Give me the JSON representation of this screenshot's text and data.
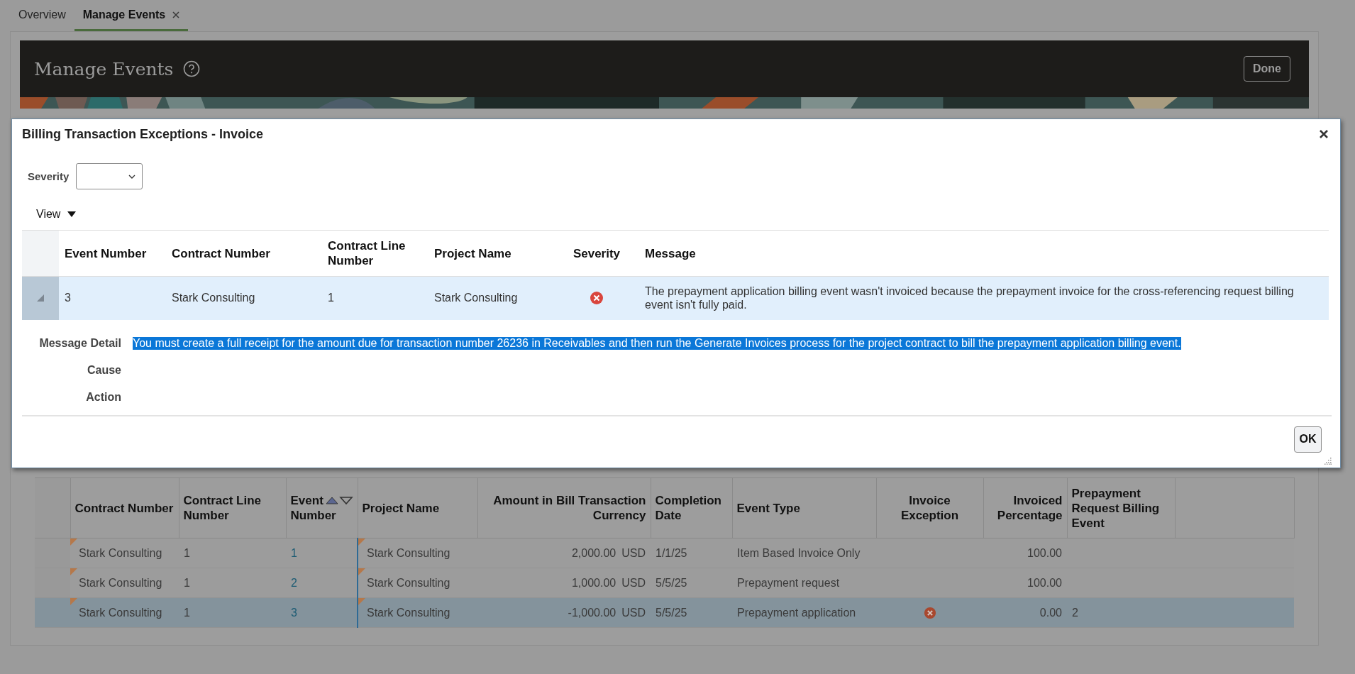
{
  "tabs": [
    {
      "label": "Overview",
      "selected": false,
      "closable": false
    },
    {
      "label": "Manage Events",
      "selected": true,
      "closable": true
    }
  ],
  "header": {
    "title": "Manage Events",
    "done_button": "Done"
  },
  "events_table": {
    "columns": [
      {
        "label": "Contract Number",
        "sortable": false
      },
      {
        "label": "Contract Line Number",
        "sortable": false
      },
      {
        "label": "Event Number",
        "sortable": true
      },
      {
        "label": "Project Name",
        "sortable": false
      },
      {
        "label": "Amount in Bill Transaction Currency",
        "sortable": false
      },
      {
        "label": "Completion Date",
        "sortable": false
      },
      {
        "label": "Event Type",
        "sortable": false
      },
      {
        "label": "Invoice Exception",
        "sortable": false
      },
      {
        "label": "Invoiced Percentage",
        "sortable": false
      },
      {
        "label": "Prepayment Request Billing Event",
        "sortable": false
      }
    ],
    "rows": [
      {
        "contract_number": "Stark Consulting",
        "contract_line": "1",
        "event_number": "1",
        "project_name": "Stark Consulting",
        "amount": "2,000.00",
        "currency": "USD",
        "completion_date": "1/1/25",
        "event_type": "Item Based Invoice Only",
        "invoice_exception": false,
        "invoiced_percentage": "100.00",
        "selected": false
      },
      {
        "contract_number": "Stark Consulting",
        "contract_line": "1",
        "event_number": "2",
        "project_name": "Stark Consulting",
        "amount": "1,000.00",
        "currency": "USD",
        "completion_date": "5/5/25",
        "event_type": "Prepayment request",
        "invoice_exception": false,
        "invoiced_percentage": "100.00",
        "selected": false
      },
      {
        "contract_number": "Stark Consulting",
        "contract_line": "1",
        "event_number": "3",
        "project_name": "Stark Consulting",
        "amount": "-1,000.00",
        "currency": "USD",
        "completion_date": "5/5/25",
        "event_type": "Prepayment application",
        "invoice_exception": true,
        "invoiced_percentage": "0.00",
        "prepayment_request_event": "2",
        "selected": true
      }
    ]
  },
  "dialog": {
    "title": "Billing Transaction Exceptions - Invoice",
    "severity_filter": {
      "label": "Severity"
    },
    "view_menu": "View",
    "columns": [
      "Event Number",
      "Contract Number",
      "Contract Line Number",
      "Project Name",
      "Severity",
      "Message"
    ],
    "rows": [
      {
        "event_number": "3",
        "contract_number": "Stark Consulting",
        "contract_line": "1",
        "project_name": "Stark Consulting",
        "kind": "error",
        "message": "The prepayment application billing event wasn't invoiced because the prepayment invoice for the cross-referencing request billing event isn't fully paid.",
        "selected": true
      }
    ],
    "details": [
      {
        "label": "Message Detail",
        "value": "You must create a full receipt for the amount due for transaction number 26236 in Receivables and then run the Generate Invoices process for the project contract to bill the prepayment application billing event.",
        "highlighted": true
      },
      {
        "label": "Cause"
      },
      {
        "label": "Action"
      }
    ],
    "ok_button": "OK"
  }
}
